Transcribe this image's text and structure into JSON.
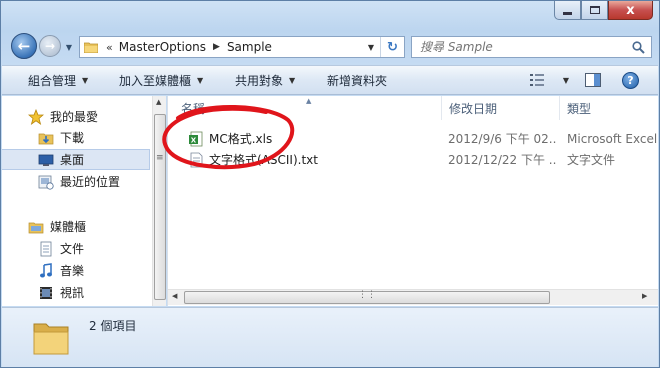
{
  "window": {
    "caption_buttons": {
      "minimize": "minimize",
      "maximize": "maximize",
      "close": "x"
    }
  },
  "address_bar": {
    "overflow_glyph": "«",
    "crumbs": [
      "MasterOptions",
      "Sample"
    ],
    "refresh_glyph": "↻"
  },
  "search": {
    "placeholder": "搜尋 Sample"
  },
  "toolbar": {
    "organize": "組合管理",
    "include_in_library": "加入至媒體櫃",
    "share_with": "共用對象",
    "new_folder": "新增資料夾",
    "help_glyph": "?"
  },
  "nav_pane": {
    "favorites": {
      "label": "我的最愛",
      "items": [
        "下載",
        "桌面",
        "最近的位置"
      ]
    },
    "libraries": {
      "label": "媒體櫃",
      "items": [
        "文件",
        "音樂",
        "視訊"
      ]
    }
  },
  "columns": {
    "name": "名稱",
    "date_modified": "修改日期",
    "type": "類型"
  },
  "files": [
    {
      "name": "MC格式.xls",
      "date": "2012/9/6 下午 02...",
      "type": "Microsoft Excel"
    },
    {
      "name": "文字格式(ASCII).txt",
      "date": "2012/12/22 下午 ...",
      "type": "文字文件"
    }
  ],
  "status_bar": {
    "item_count": "2 個項目"
  },
  "colors": {
    "annotation_red": "#e0151b",
    "window_frame": "#bcd5ef",
    "selection": "#dce6f4"
  }
}
